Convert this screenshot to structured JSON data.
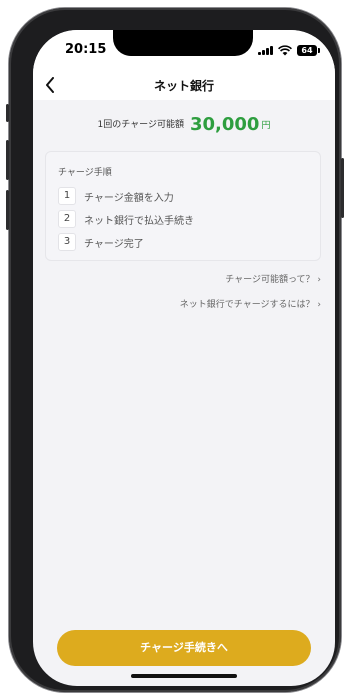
{
  "status_bar": {
    "time": "20:15",
    "battery_level": "64"
  },
  "navbar": {
    "title": "ネット銀行",
    "back_icon": "chevron-left-icon"
  },
  "charge_limit": {
    "label": "1回のチャージ可能額",
    "amount": "30,000",
    "unit": "円",
    "amount_color": "#2e9e3f"
  },
  "steps": {
    "title": "チャージ手順",
    "items": [
      {
        "number": "1",
        "text": "チャージ金額を入力"
      },
      {
        "number": "2",
        "text": "ネット銀行で払込手続き"
      },
      {
        "number": "3",
        "text": "チャージ完了"
      }
    ]
  },
  "links": [
    {
      "text": "チャージ可能額って？ ›"
    },
    {
      "text": "ネット銀行でチャージするには？ ›"
    }
  ],
  "cta": {
    "label": "チャージ手続きへ",
    "color": "#ddab1e"
  }
}
